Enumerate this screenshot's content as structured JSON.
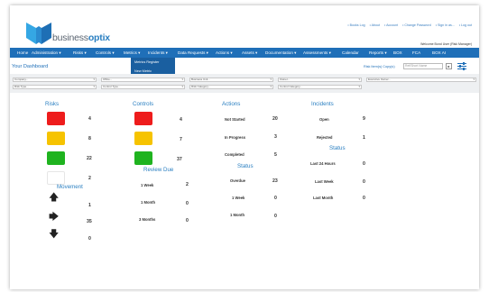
{
  "app": {
    "logo_prefix": "business",
    "logo_suffix": "optix"
  },
  "toplinks": [
    "• Books Log",
    "• About",
    "• Account",
    "• Change Password",
    "• Sign in as...",
    "• Log out"
  ],
  "welcome": "Welcome Bond User (Risk Manager)",
  "nav": [
    "Home",
    "Administration ▾",
    "Risks ▾",
    "Controls ▾",
    "Metrics ▾",
    "Incidents ▾",
    "Data Requests ▾",
    "Actions ▾",
    "Assets ▾",
    "Documentation ▾",
    "Assessments ▾",
    "Calendar",
    "Reports ▾",
    "BOX",
    "FCA",
    "BOX AI"
  ],
  "metrics_menu": [
    "Metrics Register",
    "New Metric"
  ],
  "page_title": "Your Dashboard",
  "risk_item_label": "Risk Item(s) Copy(s)",
  "risk_item_placeholder": "Ref/Short Name",
  "go_label": "▸",
  "filter_icon": "filter-sliders-icon",
  "filters": {
    "row1": [
      "Company...",
      "Office...",
      "Business Unit...",
      "Owner...",
      "Executive Owner..."
    ],
    "row2": [
      "Risk Type...",
      "Control Type...",
      "Risk Category...",
      "Control Category..."
    ]
  },
  "risks": {
    "title": "Risks",
    "colors": [
      "#ee1c1c",
      "#f6c300",
      "#1fb31f",
      "#ffffff"
    ],
    "values": [
      "4",
      "8",
      "22",
      "2"
    ]
  },
  "movement": {
    "title": "Movement",
    "icons": [
      "arrow-up-icon",
      "arrow-right-icon",
      "arrow-down-icon"
    ],
    "glyphs": [
      "🡅",
      "🡆",
      "🡇"
    ],
    "values": [
      "1",
      "35",
      "0"
    ]
  },
  "controls": {
    "title": "Controls",
    "colors": [
      "#ee1c1c",
      "#f6c300",
      "#1fb31f"
    ],
    "values": [
      "4",
      "7",
      "37"
    ]
  },
  "review_due": {
    "title": "Review Due",
    "rows": [
      {
        "label": "1 Week",
        "value": "2"
      },
      {
        "label": "1 Month",
        "value": "0"
      },
      {
        "label": "3 Months",
        "value": "0"
      }
    ]
  },
  "actions": {
    "title": "Actions",
    "rows": [
      {
        "label": "Not Started",
        "value": "20"
      },
      {
        "label": "In Progress",
        "value": "3"
      },
      {
        "label": "Completed",
        "value": "5"
      }
    ]
  },
  "action_status": {
    "title": "Status",
    "rows": [
      {
        "label": "Overdue",
        "value": "23"
      },
      {
        "label": "1 Week",
        "value": "0"
      },
      {
        "label": "1 Month",
        "value": "0"
      }
    ]
  },
  "incidents": {
    "title": "Incidents",
    "rows": [
      {
        "label": "Open",
        "value": "9"
      },
      {
        "label": "Rejected",
        "value": "1"
      }
    ]
  },
  "incident_status": {
    "title": "Status",
    "rows": [
      {
        "label": "Last 24 Hours",
        "value": "0"
      },
      {
        "label": "Last Week",
        "value": "0"
      },
      {
        "label": "Last Month",
        "value": "0"
      }
    ]
  }
}
